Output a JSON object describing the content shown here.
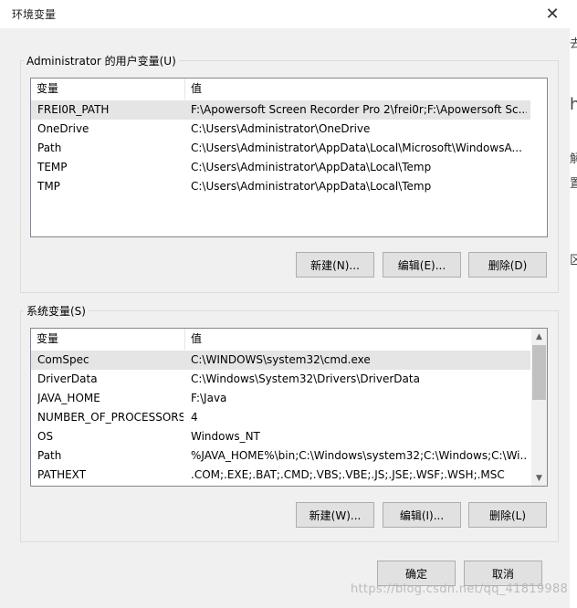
{
  "dialog": {
    "title": "环境变量",
    "close_glyph": "✕"
  },
  "user_vars": {
    "group_label": "Administrator 的用户变量(U)",
    "columns": [
      "变量",
      "值"
    ],
    "rows": [
      {
        "name": "FREI0R_PATH",
        "value": "F:\\Apowersoft Screen Recorder Pro 2\\frei0r;F:\\Apowersoft Sc...",
        "selected": true
      },
      {
        "name": "OneDrive",
        "value": "C:\\Users\\Administrator\\OneDrive",
        "selected": false
      },
      {
        "name": "Path",
        "value": "C:\\Users\\Administrator\\AppData\\Local\\Microsoft\\WindowsA...",
        "selected": false
      },
      {
        "name": "TEMP",
        "value": "C:\\Users\\Administrator\\AppData\\Local\\Temp",
        "selected": false
      },
      {
        "name": "TMP",
        "value": "C:\\Users\\Administrator\\AppData\\Local\\Temp",
        "selected": false
      }
    ],
    "buttons": {
      "new": "新建(N)...",
      "edit": "编辑(E)...",
      "delete": "删除(D)"
    }
  },
  "system_vars": {
    "group_label": "系统变量(S)",
    "columns": [
      "变量",
      "值"
    ],
    "rows": [
      {
        "name": "ComSpec",
        "value": "C:\\WINDOWS\\system32\\cmd.exe",
        "selected": true
      },
      {
        "name": "DriverData",
        "value": "C:\\Windows\\System32\\Drivers\\DriverData",
        "selected": false
      },
      {
        "name": "JAVA_HOME",
        "value": "F:\\Java",
        "selected": false
      },
      {
        "name": "NUMBER_OF_PROCESSORS",
        "value": "4",
        "selected": false
      },
      {
        "name": "OS",
        "value": "Windows_NT",
        "selected": false
      },
      {
        "name": "Path",
        "value": "%JAVA_HOME%\\bin;C:\\Windows\\system32;C:\\Windows;C:\\Wi...",
        "selected": false
      },
      {
        "name": "PATHEXT",
        "value": ".COM;.EXE;.BAT;.CMD;.VBS;.VBE;.JS;.JSE;.WSF;.WSH;.MSC",
        "selected": false
      }
    ],
    "buttons": {
      "new": "新建(W)...",
      "edit": "编辑(I)...",
      "delete": "删除(L)"
    },
    "scrollbar": {
      "up_glyph": "▲",
      "down_glyph": "▼"
    }
  },
  "footer": {
    "ok": "确定",
    "cancel": "取消"
  },
  "background": {
    "glyphs": [
      "去",
      "h",
      "解",
      "置",
      "区"
    ]
  },
  "watermark": "https://blog.csdn.net/qq_41819988"
}
